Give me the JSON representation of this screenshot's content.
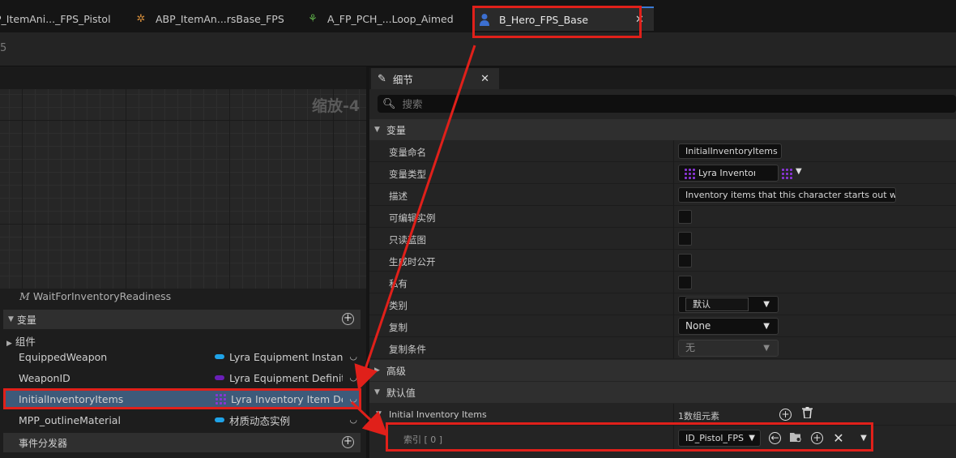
{
  "tabs": [
    {
      "label": "P_ItemAni..._FPS_Pistol",
      "icon": "animation-icon"
    },
    {
      "label": "ABP_ItemAn...rsBase_FPS",
      "icon": "anim-blueprint-icon"
    },
    {
      "label": "A_FP_PCH_...Loop_Aimed",
      "icon": "anim-sequence-icon"
    },
    {
      "label": "B_Hero_FPS_Base",
      "icon": "blueprint-character-icon",
      "active": true
    }
  ],
  "toolbar": {
    "partial_char": "5"
  },
  "graph": {
    "zoom_label": "缩放-4"
  },
  "my_blueprint": {
    "function_item": "WaitForInventoryReadiness",
    "variables_header": "变量",
    "components_label": "组件",
    "variables": [
      {
        "name": "EquippedWeapon",
        "type": "Lyra Equipment Instance",
        "color": "#1fa3e8",
        "kind": "pill"
      },
      {
        "name": "WeaponID",
        "type": "Lyra Equipment Definition",
        "color": "#6a1fb8",
        "kind": "pill"
      },
      {
        "name": "InitialInventoryItems",
        "type": "Lyra Inventory Item Definition",
        "color": "#8a35d6",
        "kind": "grid",
        "selected": true
      },
      {
        "name": "MPP_outlineMaterial",
        "type": "材质动态实例",
        "color": "#1fa3e8",
        "kind": "pill"
      }
    ],
    "dispatchers_header": "事件分发器"
  },
  "details": {
    "tab_label": "细节",
    "search_placeholder": "搜索",
    "variable_section": "变量",
    "rows": {
      "name_label": "变量命名",
      "name_value": "InitialInventoryItems",
      "type_label": "变量类型",
      "type_value": "Lyra Inventory",
      "desc_label": "描述",
      "desc_value": "Inventory items that this character starts out with",
      "editable_label": "可编辑实例",
      "readonly_label": "只读蓝图",
      "expose_label": "生成时公开",
      "private_label": "私有",
      "category_label": "类别",
      "category_value": "默认",
      "replication_label": "复制",
      "replication_value": "None",
      "repcond_label": "复制条件",
      "repcond_value": "无"
    },
    "advanced_section": "高级",
    "default_section": "默认值",
    "array": {
      "label": "Initial Inventory Items",
      "count_text": "1数组元素",
      "index_label": "索引 [ 0 ]",
      "index_value": "ID_Pistol_FPS"
    }
  },
  "colors": {
    "accent_red": "#e0201a",
    "selection": "#3d5a7a"
  }
}
